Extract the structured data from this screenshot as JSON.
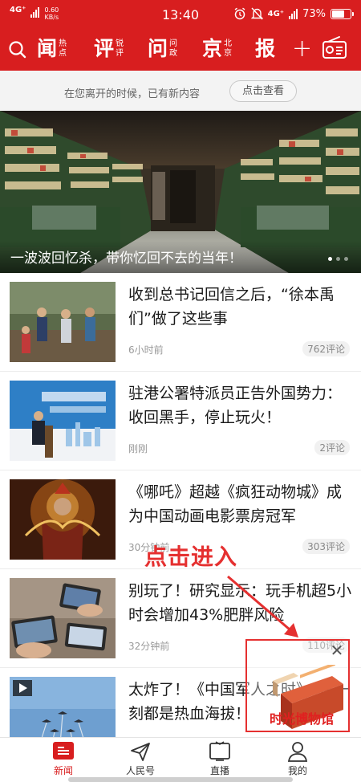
{
  "status_bar": {
    "network": "4G⁺",
    "speed_value": "0.60",
    "speed_unit": "KB/s",
    "time": "13:40",
    "network_right": "4G⁺",
    "battery_percent": "73%",
    "battery_level": 0.73
  },
  "channels": [
    {
      "main": "闻",
      "sub1": "热",
      "sub2": "点"
    },
    {
      "main": "评",
      "sub1": "锐",
      "sub2": "评"
    },
    {
      "main": "问",
      "sub1": "问",
      "sub2": "政"
    },
    {
      "main": "京",
      "sub1": "北",
      "sub2": "京"
    },
    {
      "main": "报",
      "sub1": "",
      "sub2": ""
    }
  ],
  "nav": {
    "plus_label": "+"
  },
  "notice": {
    "text": "在您离开的时候，已有新内容",
    "button": "点击查看"
  },
  "banner": {
    "title": "一波波回忆杀，带你忆回不去的当年！",
    "dots": 3
  },
  "news": [
    {
      "title": "收到总书记回信之后，“徐本禹们”做了这些事",
      "time": "6小时前",
      "comments": "762评论"
    },
    {
      "title": "驻港公署特派员正告外国势力：收回黑手，停止玩火！",
      "time": "刚刚",
      "comments": "2评论"
    },
    {
      "title": "《哪吒》超越《疯狂动物城》成为中国动画电影票房冠军",
      "time": "30分钟前",
      "comments": "303评论"
    },
    {
      "title": "别玩了！研究显示：玩手机超5小时会增加43%肥胖风险",
      "time": "32分钟前",
      "comments": "110评论"
    },
    {
      "title": "太炸了！《中国军人之时》，每一刻都是热血海拔！",
      "time": "",
      "comments": ""
    }
  ],
  "annotation": {
    "text": "点击进入"
  },
  "popup": {
    "label": "时光博物馆",
    "close": "✕"
  },
  "bottom_nav": {
    "tabs": [
      {
        "label": "新闻",
        "icon": "news-icon"
      },
      {
        "label": "人民号",
        "icon": "paper-plane-icon"
      },
      {
        "label": "直播",
        "icon": "tv-icon"
      },
      {
        "label": "我的",
        "icon": "person-icon"
      }
    ]
  },
  "colors": {
    "brand_red": "#d81e1f",
    "annotation_red": "#e53030"
  }
}
